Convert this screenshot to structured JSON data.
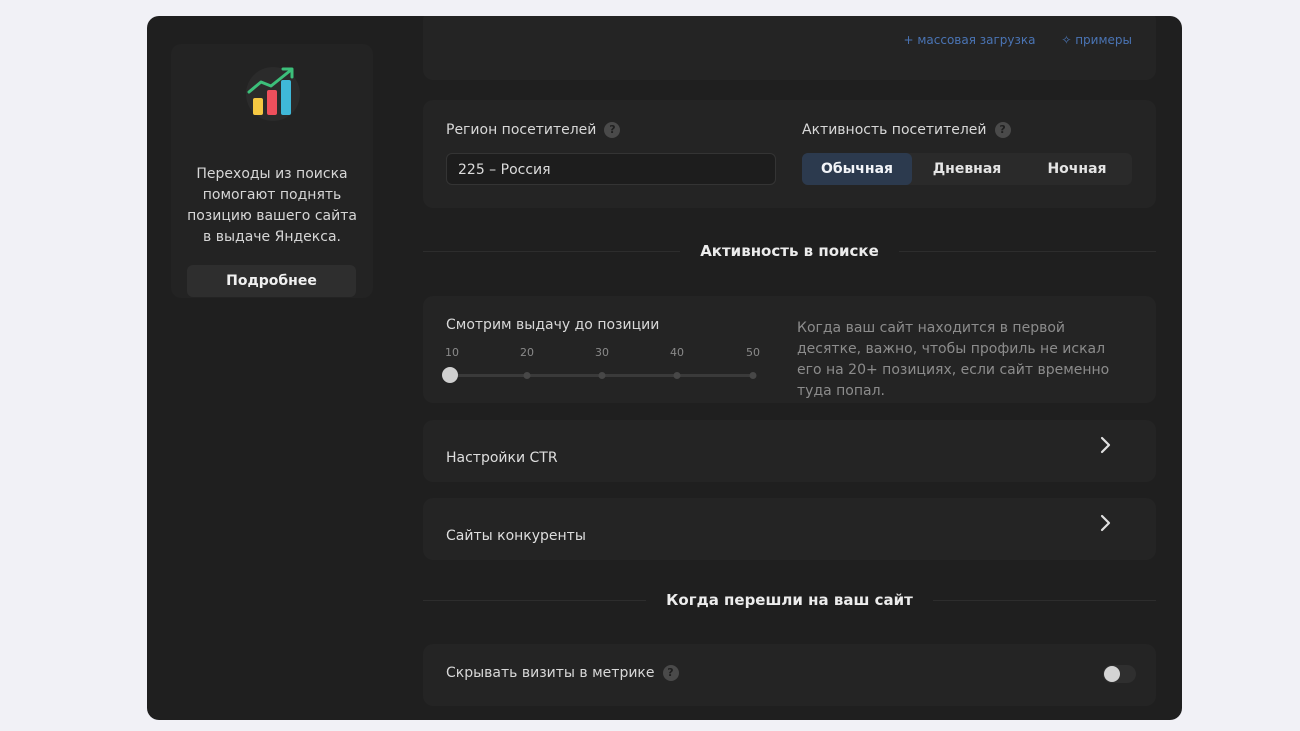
{
  "promo": {
    "text": "Переходы из поиска\nпомогают поднять\nпозицию вашего сайта\nв выдаче Яндекса.",
    "button_label": "Подробнее",
    "icon": "bar-chart-growth-icon"
  },
  "top_links": {
    "bulk_upload": "+ массовая загрузка",
    "examples": "✧ примеры"
  },
  "region": {
    "label": "Регион посетителей",
    "value": "225 – Россия"
  },
  "activity": {
    "label": "Активность посетителей",
    "options": [
      "Обычная",
      "Дневная",
      "Ночная"
    ],
    "selected": "Обычная"
  },
  "section_search": {
    "title": "Активность в поиске"
  },
  "position": {
    "label": "Смотрим выдачу до позиции",
    "ticks": [
      "10",
      "20",
      "30",
      "40",
      "50"
    ],
    "value": 10,
    "hint": "Когда ваш сайт находится в первой десятке, важно, чтобы профиль не искал его на 20+ позициях, если сайт временно туда попал."
  },
  "ctr": {
    "label": "Настройки CTR"
  },
  "competitors": {
    "label": "Сайты конкуренты"
  },
  "section_visit": {
    "title": "Когда перешли на ваш сайт"
  },
  "hide_visits": {
    "label": "Скрывать визиты в метрике",
    "enabled": false
  },
  "colors": {
    "accent_selected": "#2c3a4e",
    "link": "#4a74b4",
    "background": "#1f1f1f"
  }
}
